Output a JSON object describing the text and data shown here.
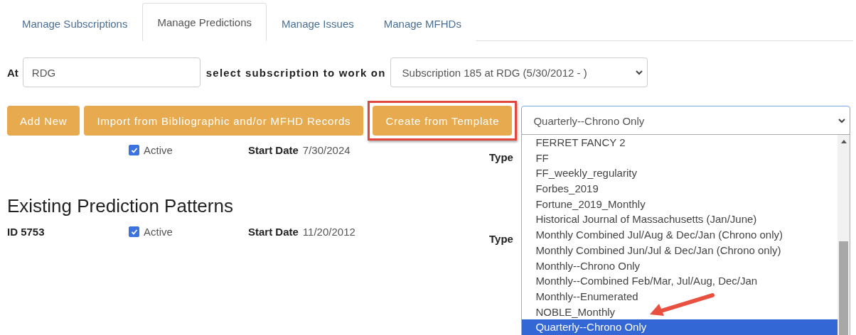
{
  "tabs": [
    {
      "label": "Manage Subscriptions",
      "selected": false
    },
    {
      "label": "Manage Predictions",
      "selected": true
    },
    {
      "label": "Manage Issues",
      "selected": false
    },
    {
      "label": "Manage MFHDs",
      "selected": false
    }
  ],
  "location": {
    "label": "At",
    "value": "RDG"
  },
  "subscription": {
    "label": "select subscription to work on",
    "value": "Subscription 185 at RDG (5/30/2012 - )"
  },
  "buttons": [
    {
      "label": "Add New",
      "highlighted": false
    },
    {
      "label": "Import from Bibliographic and/or MFHD Records",
      "highlighted": false
    },
    {
      "label": "Create from Template",
      "highlighted": true
    }
  ],
  "template_select": {
    "value": "Quarterly--Chrono Only",
    "options": [
      {
        "label": "FERRET FANCY 2",
        "selected": false
      },
      {
        "label": "FF",
        "selected": false
      },
      {
        "label": "FF_weekly_regularity",
        "selected": false
      },
      {
        "label": "Forbes_2019",
        "selected": false
      },
      {
        "label": "Fortune_2019_Monthly",
        "selected": false
      },
      {
        "label": "Historical Journal of Massachusetts (Jan/June)",
        "selected": false
      },
      {
        "label": "Monthly Combined Jul/Aug & Dec/Jan (Chrono only)",
        "selected": false
      },
      {
        "label": "Monthly Combined Jun/Jul & Dec/Jan (Chrono only)",
        "selected": false
      },
      {
        "label": "Monthly--Chrono Only",
        "selected": false
      },
      {
        "label": "Monthly--Combined Feb/Mar, Jul/Aug, Dec/Jan",
        "selected": false
      },
      {
        "label": "Monthly--Enumerated",
        "selected": false
      },
      {
        "label": "NOBLE_Monthly",
        "selected": false
      },
      {
        "label": "Quarterly--Chrono Only",
        "selected": true
      }
    ]
  },
  "new_pattern": {
    "active_label": "Active",
    "active": true,
    "start_date_label": "Start Date",
    "start_date": "7/30/2024",
    "type_label": "Type"
  },
  "heading": "Existing Prediction Patterns",
  "patterns": [
    {
      "id": "ID 5753",
      "active_label": "Active",
      "active": true,
      "start_date_label": "Start Date",
      "start_date": "11/20/2012",
      "type_label": "Type"
    }
  ]
}
